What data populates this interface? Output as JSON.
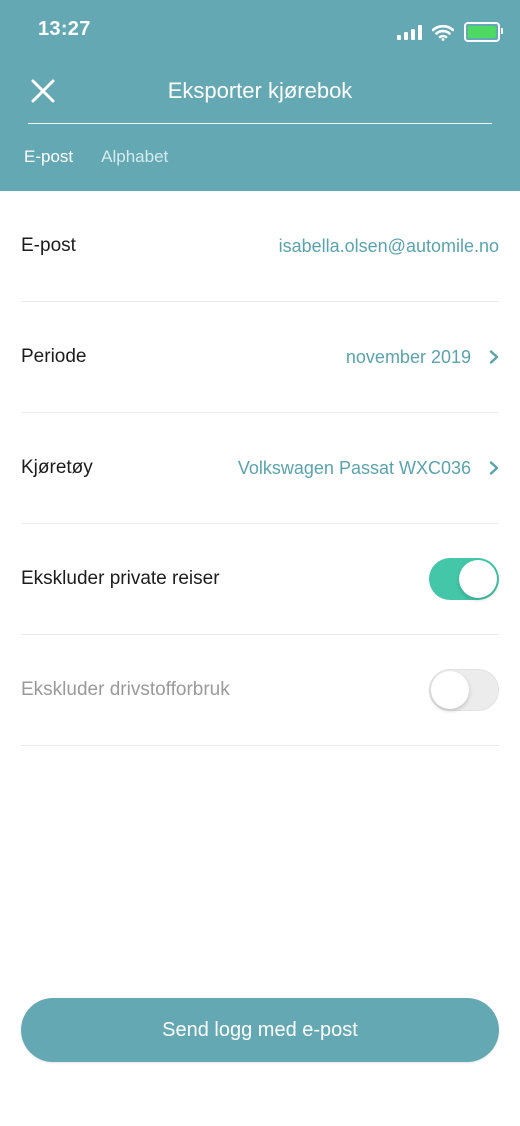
{
  "status": {
    "time": "13:27",
    "battery_color": "#4cd964"
  },
  "header": {
    "title": "Eksporter kjørebok",
    "close_icon": "close-icon",
    "tabs": [
      {
        "label": "E-post",
        "active": true
      },
      {
        "label": "Alphabet",
        "active": false
      }
    ]
  },
  "form": {
    "email": {
      "label": "E-post",
      "value": "isabella.olsen@automile.no"
    },
    "period": {
      "label": "Periode",
      "value": "november 2019"
    },
    "vehicle": {
      "label": "Kjøretøy",
      "value": "Volkswagen Passat WXC036"
    },
    "exclude_private": {
      "label": "Ekskluder private reiser",
      "enabled": true
    },
    "exclude_fuel": {
      "label": "Ekskluder drivstofforbruk",
      "enabled": false
    }
  },
  "actions": {
    "send_label": "Send logg med e-post"
  },
  "colors": {
    "brand": "#63a8b3",
    "accent_text": "#5aa3ad",
    "toggle_on": "#43c7a8"
  }
}
